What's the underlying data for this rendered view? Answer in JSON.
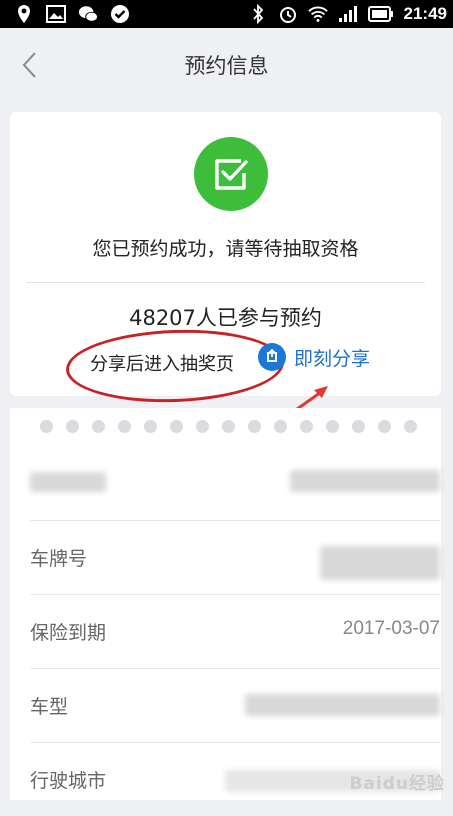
{
  "status_bar": {
    "time": "21:49",
    "left_icons": [
      "location-icon",
      "image-icon",
      "wechat-icon",
      "check-circle-icon"
    ],
    "right_icons": [
      "bluetooth-icon",
      "alarm-icon",
      "wifi-icon",
      "signal-icon",
      "battery-icon"
    ]
  },
  "nav": {
    "title": "预约信息",
    "back_icon": "chevron-left-icon"
  },
  "result": {
    "icon": "checkbox-icon",
    "icon_color": "#3dbd3a",
    "success_text": "您已预约成功，请等待抽取资格",
    "count_text": "48207人已参与预约",
    "share_hint": "分享后进入抽奖页",
    "share_label": "即刻分享",
    "share_color": "#1f6fd0",
    "annotation_color": "#c72226"
  },
  "info": {
    "rows": [
      {
        "label": "",
        "value": ""
      },
      {
        "label": "车牌号",
        "value": ""
      },
      {
        "label": "保险到期",
        "value": "2017-03-07"
      },
      {
        "label": "车型",
        "value": ""
      },
      {
        "label": "行驶城市",
        "value": ""
      }
    ]
  },
  "watermark": "Baidu经验"
}
